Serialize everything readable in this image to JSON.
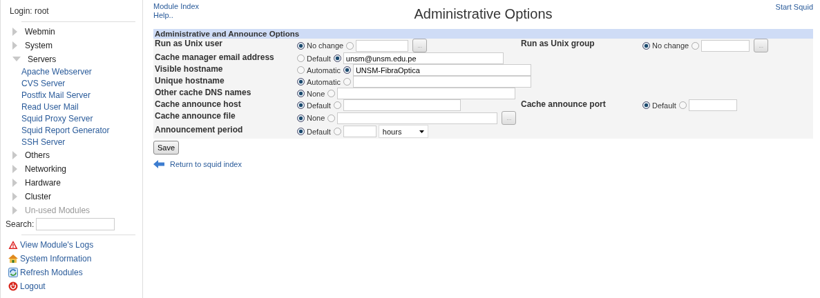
{
  "sidebar": {
    "login": "Login: root",
    "categories": [
      {
        "label": "Webmin",
        "expanded": false,
        "disabled": false
      },
      {
        "label": "System",
        "expanded": false,
        "disabled": false
      },
      {
        "label": "Servers",
        "expanded": true,
        "disabled": false,
        "children": [
          "Apache Webserver",
          "CVS Server",
          "Postfix Mail Server",
          "Read User Mail",
          "Squid Proxy Server",
          "Squid Report Generator",
          "SSH Server"
        ]
      },
      {
        "label": "Others",
        "expanded": false,
        "disabled": false
      },
      {
        "label": "Networking",
        "expanded": false,
        "disabled": false
      },
      {
        "label": "Hardware",
        "expanded": false,
        "disabled": false
      },
      {
        "label": "Cluster",
        "expanded": false,
        "disabled": false
      },
      {
        "label": "Un-used Modules",
        "expanded": false,
        "disabled": true
      }
    ],
    "search_label": "Search:",
    "links": [
      {
        "label": "View Module's Logs",
        "kind": "warning"
      },
      {
        "label": "System Information",
        "kind": "house"
      },
      {
        "label": "Refresh Modules",
        "kind": "refresh"
      },
      {
        "label": "Logout",
        "kind": "power"
      }
    ]
  },
  "header": {
    "links": [
      "Module Index",
      "Help.."
    ],
    "title": "Administrative Options",
    "action": "Start Squid"
  },
  "form": {
    "section": "Administrative and Announce Options",
    "rows": [
      [
        {
          "label": "Run as Unix user",
          "options": [
            {
              "label": "No change",
              "selected": true
            },
            {
              "selected": false
            }
          ],
          "input": {
            "kind": "medium"
          },
          "chooser": "..."
        },
        {
          "label": "Run as Unix group",
          "options": [
            {
              "label": "No change",
              "selected": true
            },
            {
              "selected": false
            }
          ],
          "input": {
            "kind": "short"
          },
          "chooser": "..."
        }
      ],
      [
        {
          "label": "Cache manager email address",
          "options": [
            {
              "label": "Default",
              "selected": false
            },
            {
              "selected": true
            }
          ],
          "input": {
            "kind": "long",
            "value": "unsm@unsm.edu.pe"
          }
        }
      ],
      [
        {
          "label": "Visible hostname",
          "options": [
            {
              "label": "Automatic",
              "selected": false
            },
            {
              "selected": true
            }
          ],
          "input": {
            "kind": "full",
            "value": "UNSM-FibraOptica"
          }
        }
      ],
      [
        {
          "label": "Unique hostname",
          "options": [
            {
              "label": "Automatic",
              "selected": true
            },
            {
              "selected": false
            }
          ],
          "input": {
            "kind": "full"
          }
        }
      ],
      [
        {
          "label": "Other cache DNS names",
          "options": [
            {
              "label": "None",
              "selected": true
            },
            {
              "selected": false
            }
          ],
          "input": {
            "kind": "full"
          }
        }
      ],
      [
        {
          "label": "Cache announce host",
          "options": [
            {
              "label": "Default",
              "selected": true
            },
            {
              "selected": false
            }
          ],
          "input": {
            "kind": "wide"
          }
        },
        {
          "label": "Cache announce port",
          "options": [
            {
              "label": "Default",
              "selected": true
            },
            {
              "selected": false
            }
          ],
          "input": {
            "kind": "short"
          }
        }
      ],
      [
        {
          "label": "Cache announce file",
          "options": [
            {
              "label": "None",
              "selected": true
            },
            {
              "selected": false
            }
          ],
          "input": {
            "kind": "long"
          },
          "chooser": "..."
        }
      ],
      [
        {
          "label": "Announcement period",
          "options": [
            {
              "label": "Default",
              "selected": true
            },
            {
              "selected": false
            }
          ],
          "input": {
            "kind": "tiny"
          },
          "select": "hours"
        }
      ]
    ],
    "save": "Save",
    "back_link": "Return to squid index"
  }
}
